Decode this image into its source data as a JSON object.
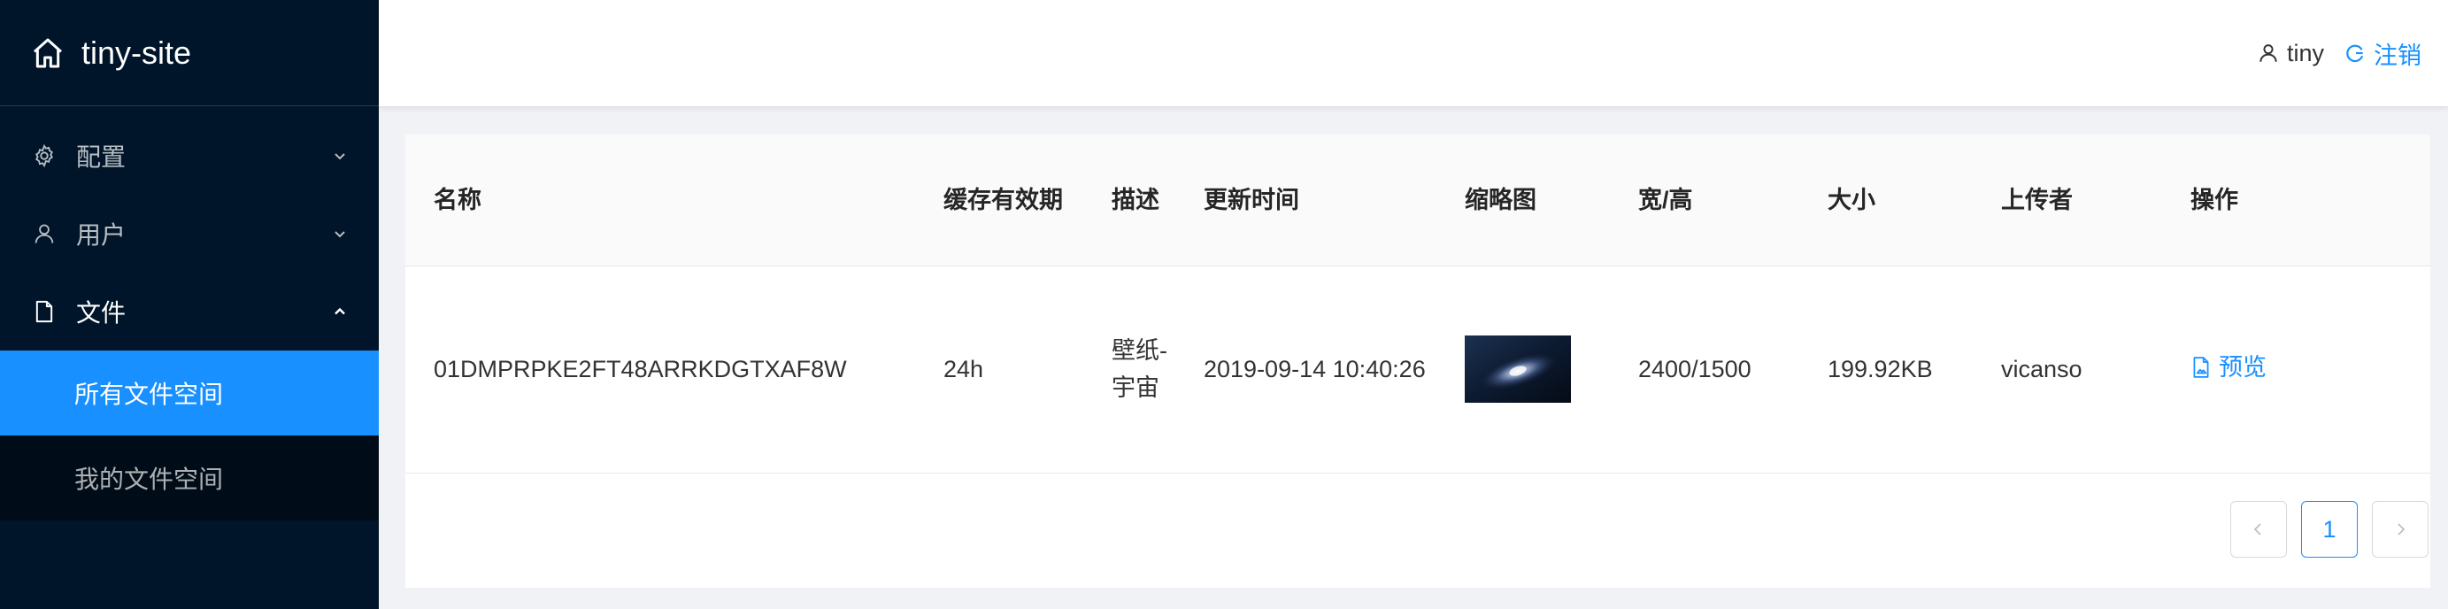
{
  "app": {
    "title": "tiny-site"
  },
  "sidebar": {
    "menus": [
      {
        "label": "配置",
        "icon": "gear-icon"
      },
      {
        "label": "用户",
        "icon": "user-icon"
      },
      {
        "label": "文件",
        "icon": "file-icon"
      }
    ],
    "sub_items": [
      {
        "label": "所有文件空间",
        "active": true
      },
      {
        "label": "我的文件空间",
        "active": false
      }
    ]
  },
  "header": {
    "username": "tiny",
    "logout_label": "注销"
  },
  "table": {
    "columns": [
      "名称",
      "缓存有效期",
      "描述",
      "更新时间",
      "缩略图",
      "宽/高",
      "大小",
      "上传者",
      "操作"
    ],
    "rows": [
      {
        "name": "01DMPRPKE2FT48ARRKDGTXAF8W",
        "cache": "24h",
        "desc": "壁纸-宇宙",
        "updated": "2019-09-14 10:40:26",
        "thumbnail": "galaxy image",
        "size_wh": "2400/1500",
        "filesize": "199.92KB",
        "uploader": "vicanso",
        "action": "预览"
      }
    ]
  },
  "pagination": {
    "current": "1"
  },
  "colors": {
    "sidebar_bg": "#001529",
    "accent": "#1890ff"
  }
}
